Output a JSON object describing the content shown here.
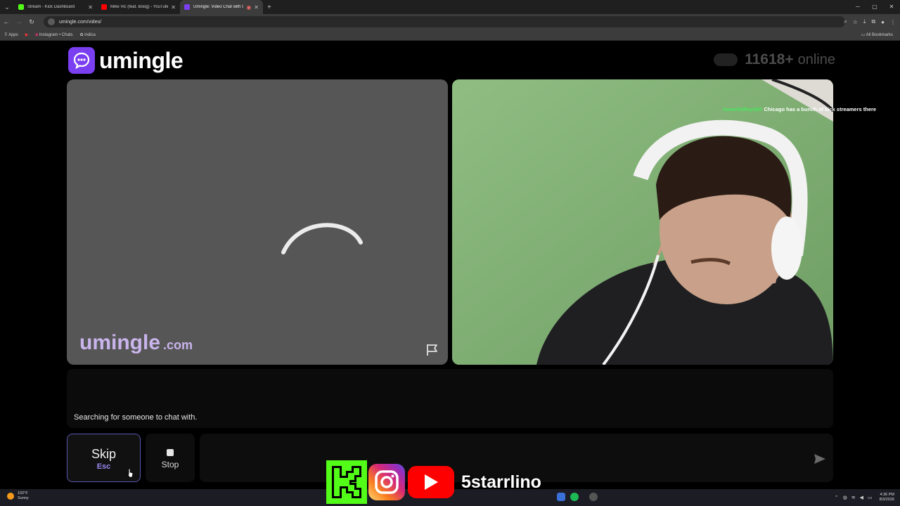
{
  "browser": {
    "tabs": [
      {
        "title": "Stream - Kick Dashboard",
        "favicon_color": "#53fc18",
        "active": false
      },
      {
        "title": "Mike Vic (feat. Boog) - YouTube",
        "favicon_color": "#ff0000",
        "active": false
      },
      {
        "title": "Umingle: Video Chat with S",
        "favicon_color": "#7b3ff2",
        "active": true
      }
    ],
    "url": "umingle.com/video/",
    "bookmarks": {
      "apps": "Apps",
      "items": [
        "Instagram • Chats",
        "indica"
      ],
      "all": "All Bookmarks"
    }
  },
  "page": {
    "logo_text": "umingle",
    "online_count": "11618+",
    "online_label": "online",
    "watermark_main": "umingle",
    "watermark_suffix": ".com",
    "status_text": "Searching for someone to chat with.",
    "skip_label": "Skip",
    "skip_key": "Esc",
    "stop_label": "Stop",
    "message_placeholder": "",
    "accent_color": "#7b3ff2"
  },
  "stream_chat": {
    "user": "AmorDeRey360",
    "message": "Chicago has a bunch of kick streamers there"
  },
  "overlay": {
    "handle": "5starrlino"
  },
  "taskbar": {
    "temperature": "102°F",
    "condition": "Sunny",
    "time": "4:36 PM",
    "date": "8/3/2026"
  }
}
